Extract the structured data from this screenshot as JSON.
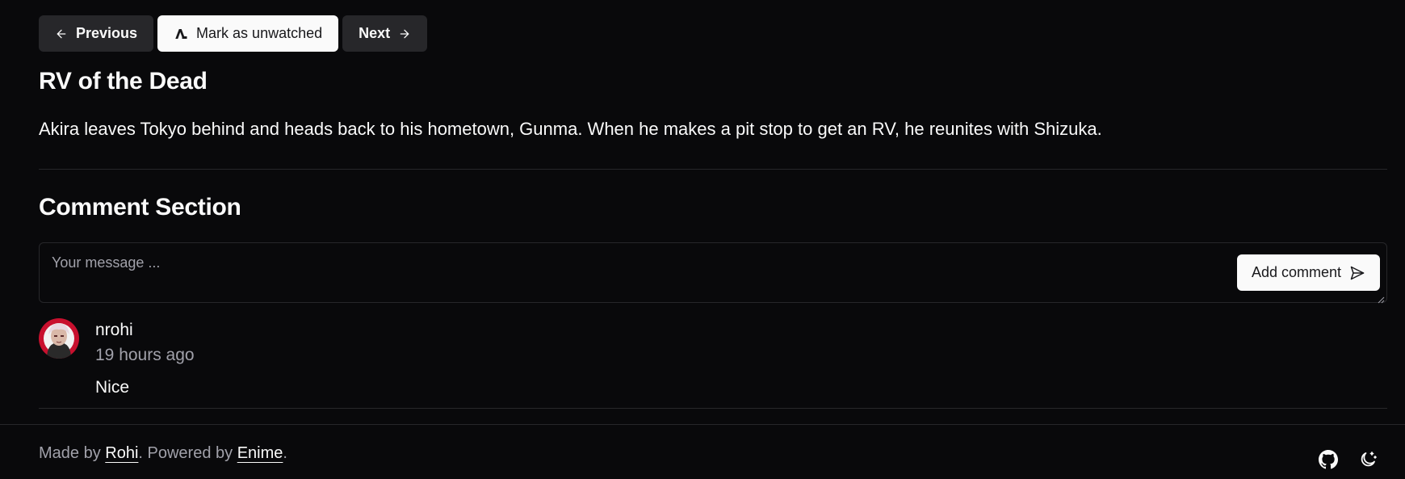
{
  "nav": {
    "previous_label": "Previous",
    "mark_label": "Mark as unwatched",
    "next_label": "Next"
  },
  "episode": {
    "title": "RV of the Dead",
    "description": "Akira leaves Tokyo behind and heads back to his hometown, Gunma. When he makes a pit stop to get an RV, he reunites with Shizuka."
  },
  "comments": {
    "heading": "Comment Section",
    "input_placeholder": "Your message ...",
    "input_value": "",
    "add_label": "Add comment",
    "items": [
      {
        "author": "nrohi",
        "time": "19 hours ago",
        "text": "Nice"
      }
    ]
  },
  "footer": {
    "made_by_prefix": "Made by ",
    "made_by_link": "Rohi",
    "powered_prefix": ". Powered by ",
    "powered_link": "Enime",
    "suffix": "."
  },
  "icons": {
    "previous": "arrow-left-icon",
    "mark": "anilist-icon",
    "next": "arrow-right-icon",
    "send": "send-icon",
    "github": "github-icon",
    "theme": "moon-stars-icon"
  },
  "colors": {
    "background": "#09090b",
    "button_dark": "#27272a",
    "button_light": "#fafafa",
    "muted_text": "#a1a1aa",
    "border": "#27272a"
  }
}
